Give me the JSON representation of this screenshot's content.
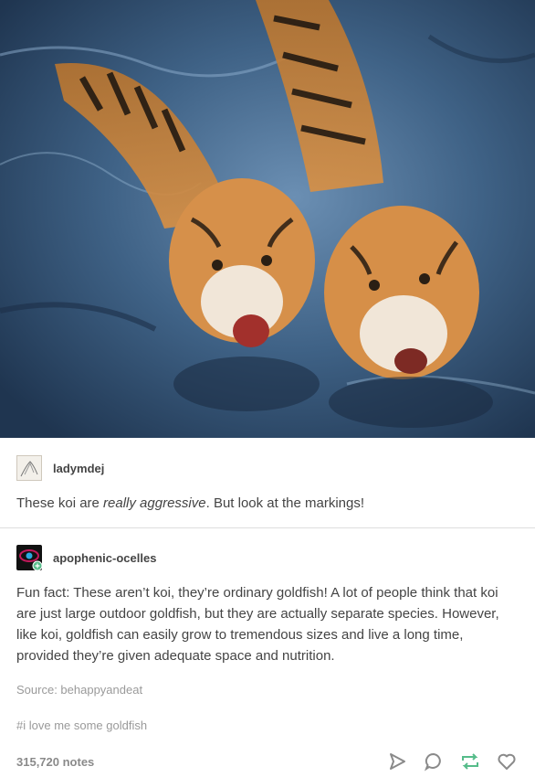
{
  "post": {
    "reblogs": [
      {
        "username": "ladymdej",
        "text_before": "These koi are ",
        "text_emphasis": "really aggressive",
        "text_after": ". But look at the markings!"
      },
      {
        "username": "apophenic-ocelles",
        "text": "Fun fact: These aren’t koi, they’re ordinary goldfish! A lot of people think that koi are just large outdoor goldfish, but they are actually separate species. However, like koi, goldfish can easily grow to tremendous sizes and live a long time, provided they’re given adequate space and nutrition."
      }
    ],
    "source": "Source: behappyandeat",
    "tag": "#i love me some goldfish",
    "notes": "315,720 notes"
  },
  "icons": {
    "share": "share-icon",
    "reply": "reply-icon",
    "reblog": "reblog-icon",
    "like": "heart-icon"
  },
  "colors": {
    "reblog_green": "#56bc8a",
    "icon_gray": "#8a8a8a"
  }
}
